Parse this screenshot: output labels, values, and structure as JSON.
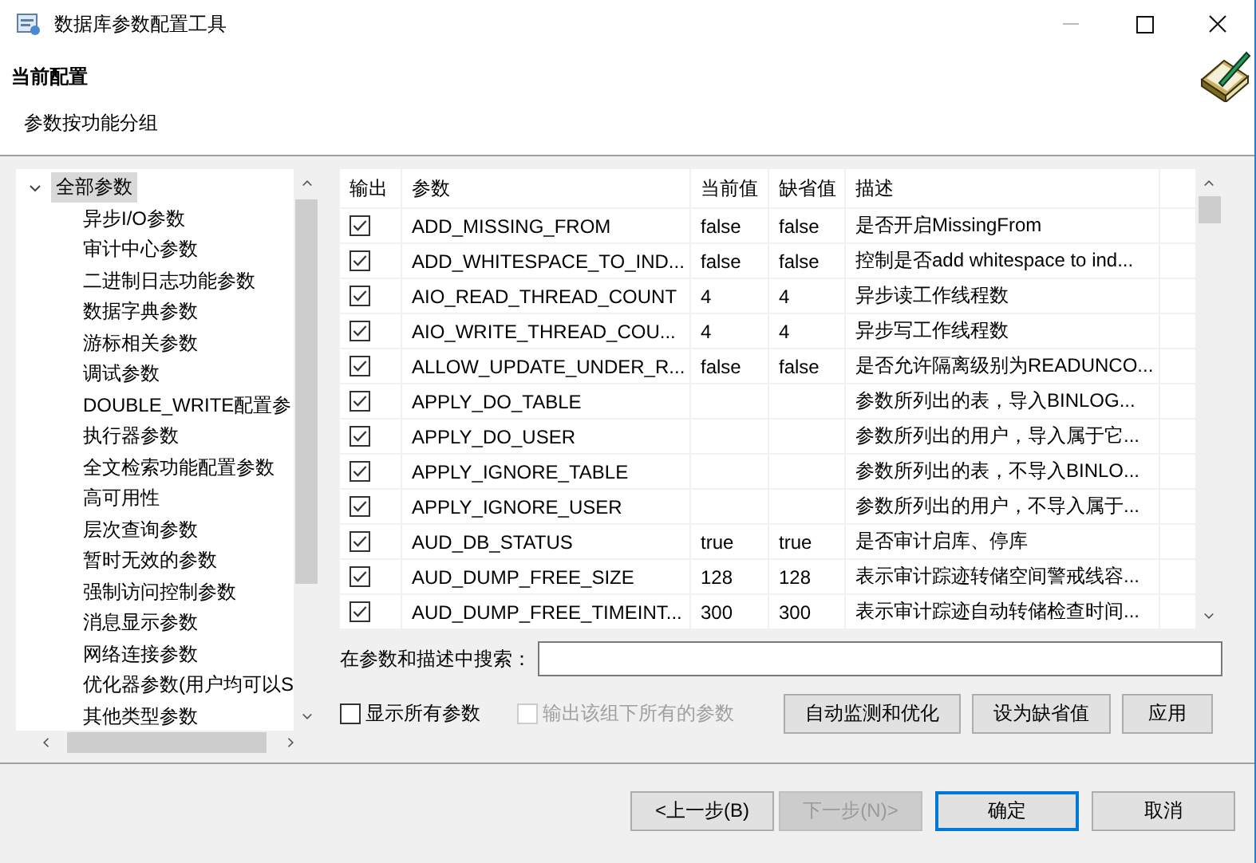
{
  "window": {
    "title": "数据库参数配置工具"
  },
  "header": {
    "title": "当前配置",
    "subtitle": "参数按功能分组"
  },
  "tree": {
    "root": {
      "label": "全部参数",
      "expanded": true,
      "selected": true,
      "children": [
        {
          "label": "异步I/O参数",
          "selected": false
        },
        {
          "label": "审计中心参数",
          "selected": false
        },
        {
          "label": "二进制日志功能参数",
          "selected": false
        },
        {
          "label": "数据字典参数",
          "selected": false
        },
        {
          "label": "游标相关参数",
          "selected": false
        },
        {
          "label": "调试参数",
          "selected": false
        },
        {
          "label": "DOUBLE_WRITE配置参",
          "selected": false
        },
        {
          "label": "执行器参数",
          "selected": false
        },
        {
          "label": "全文检索功能配置参数",
          "selected": false
        },
        {
          "label": "高可用性",
          "selected": false
        },
        {
          "label": "层次查询参数",
          "selected": false
        },
        {
          "label": "暂时无效的参数",
          "selected": false
        },
        {
          "label": "强制访问控制参数",
          "selected": false
        },
        {
          "label": "消息显示参数",
          "selected": false
        },
        {
          "label": "网络连接参数",
          "selected": false
        },
        {
          "label": "优化器参数(用户均可以S",
          "selected": false
        },
        {
          "label": "其他类型参数",
          "selected": false
        }
      ]
    }
  },
  "table": {
    "columns": [
      "输出",
      "参数",
      "当前值",
      "缺省值",
      "描述"
    ],
    "rows": [
      {
        "checked": true,
        "param": "ADD_MISSING_FROM",
        "current": "false",
        "default": "false",
        "description": "是否开启MissingFrom"
      },
      {
        "checked": true,
        "param": "ADD_WHITESPACE_TO_IND...",
        "current": "false",
        "default": "false",
        "description": "控制是否add whitespace to ind..."
      },
      {
        "checked": true,
        "param": "AIO_READ_THREAD_COUNT",
        "current": "4",
        "default": "4",
        "description": "异步读工作线程数"
      },
      {
        "checked": true,
        "param": "AIO_WRITE_THREAD_COU...",
        "current": "4",
        "default": "4",
        "description": "异步写工作线程数"
      },
      {
        "checked": true,
        "param": "ALLOW_UPDATE_UNDER_R...",
        "current": "false",
        "default": "false",
        "description": "是否允许隔离级别为READUNCO..."
      },
      {
        "checked": true,
        "param": "APPLY_DO_TABLE",
        "description": "参数所列出的表，导入BINLOG..."
      },
      {
        "checked": true,
        "param": "APPLY_DO_USER",
        "description": "参数所列出的用户，导入属于它..."
      },
      {
        "checked": true,
        "param": "APPLY_IGNORE_TABLE",
        "description": "参数所列出的表，不导入BINLO..."
      },
      {
        "checked": true,
        "param": "APPLY_IGNORE_USER",
        "description": "参数所列出的用户，不导入属于..."
      },
      {
        "checked": true,
        "param": "AUD_DB_STATUS",
        "current": "true",
        "default": "true",
        "description": "是否审计启库、停库"
      },
      {
        "checked": true,
        "param": "AUD_DUMP_FREE_SIZE",
        "current": "128",
        "default": "128",
        "description": "表示审计踪迹转储空间警戒线容..."
      },
      {
        "checked": true,
        "param": "AUD_DUMP_FREE_TIMEINT...",
        "current": "300",
        "default": "300",
        "description": "表示审计踪迹自动转储检查时间..."
      }
    ]
  },
  "search": {
    "label": "在参数和描述中搜索："
  },
  "options": [
    {
      "label": "显示所有参数",
      "checked": false,
      "disabled": false
    },
    {
      "label": "输出该组下所有的参数",
      "checked": false,
      "disabled": true
    }
  ],
  "actions": [
    "自动监测和优化",
    "设为缺省值",
    "应用"
  ],
  "footer_buttons": [
    {
      "label": "<上一步(B)",
      "disabled": false,
      "default": false
    },
    {
      "label": "下一步(N)>",
      "disabled": true,
      "default": false
    },
    {
      "label": "确定",
      "disabled": false,
      "default": true
    },
    {
      "label": "取消",
      "disabled": false,
      "default": false
    }
  ]
}
